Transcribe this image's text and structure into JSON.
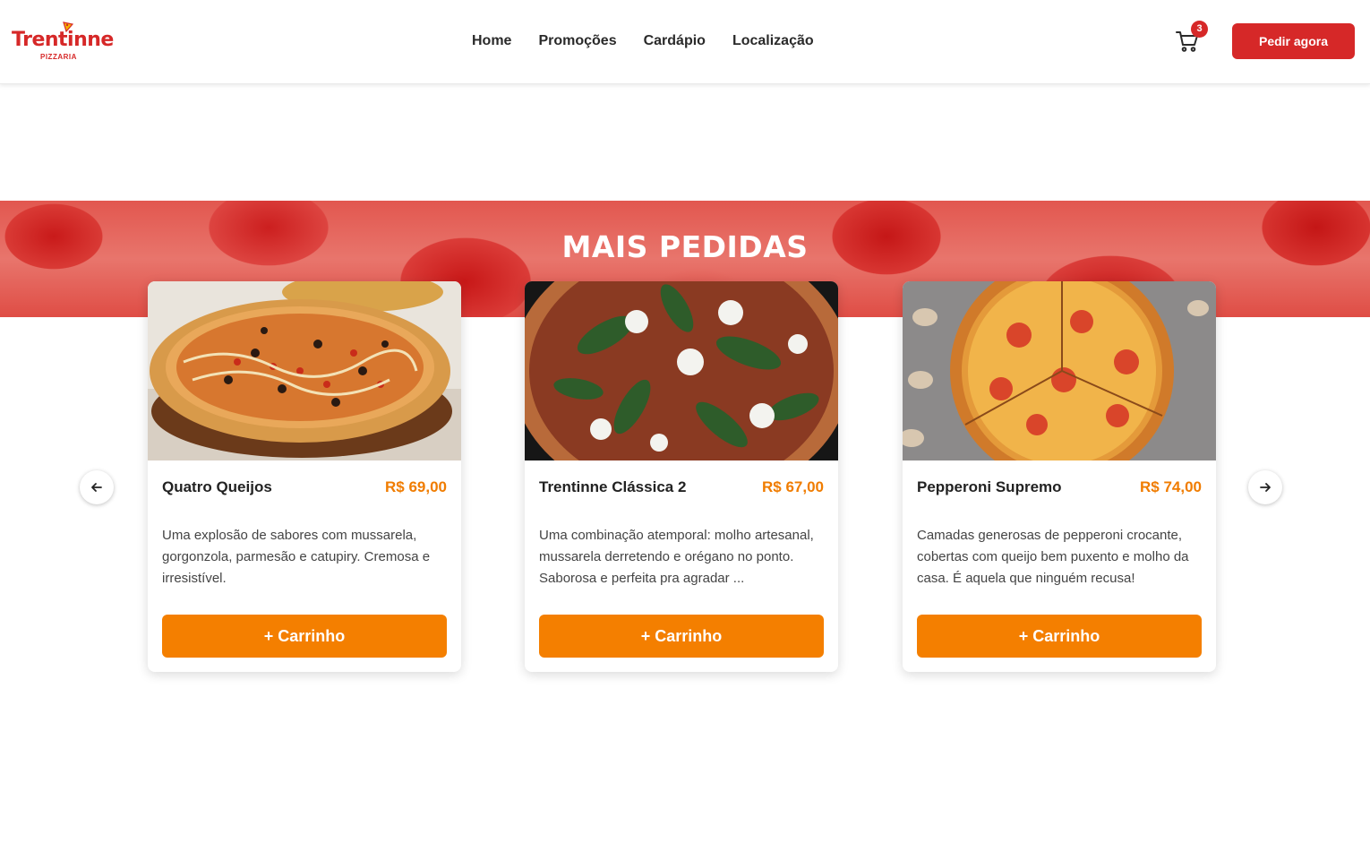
{
  "header": {
    "logo_name": "Trentinne",
    "logo_sub": "PIZZARIA",
    "nav": [
      "Home",
      "Promoções",
      "Cardápio",
      "Localização"
    ],
    "cart_count": "3",
    "order_button": "Pedir agora"
  },
  "section": {
    "title": "MAIS PEDIDAS"
  },
  "products": [
    {
      "name": "Quatro Queijos",
      "price": "R$ 69,00",
      "description": "Uma explosão de sabores com mussarela, gorgonzola, parmesão e catupiry. Cremosa e irresistível.",
      "button": "+ Carrinho"
    },
    {
      "name": "Trentinne Clássica 2",
      "price": "R$ 67,00",
      "description": "Uma combinação atemporal: molho artesanal, mussarela derretendo e orégano no ponto. Saborosa e perfeita pra agradar ...",
      "button": "+ Carrinho"
    },
    {
      "name": "Pepperoni Supremo",
      "price": "R$ 74,00",
      "description": "Camadas generosas de pepperoni crocante, cobertas com queijo bem puxento e molho da casa. É aquela que ninguém recusa!",
      "button": "+ Carrinho"
    }
  ],
  "colors": {
    "brand_red": "#d62828",
    "accent_orange": "#f47f00",
    "price_orange": "#f07c00"
  },
  "icons": {
    "cart": "cart-icon",
    "prev": "arrow-left-icon",
    "next": "arrow-right-icon"
  }
}
